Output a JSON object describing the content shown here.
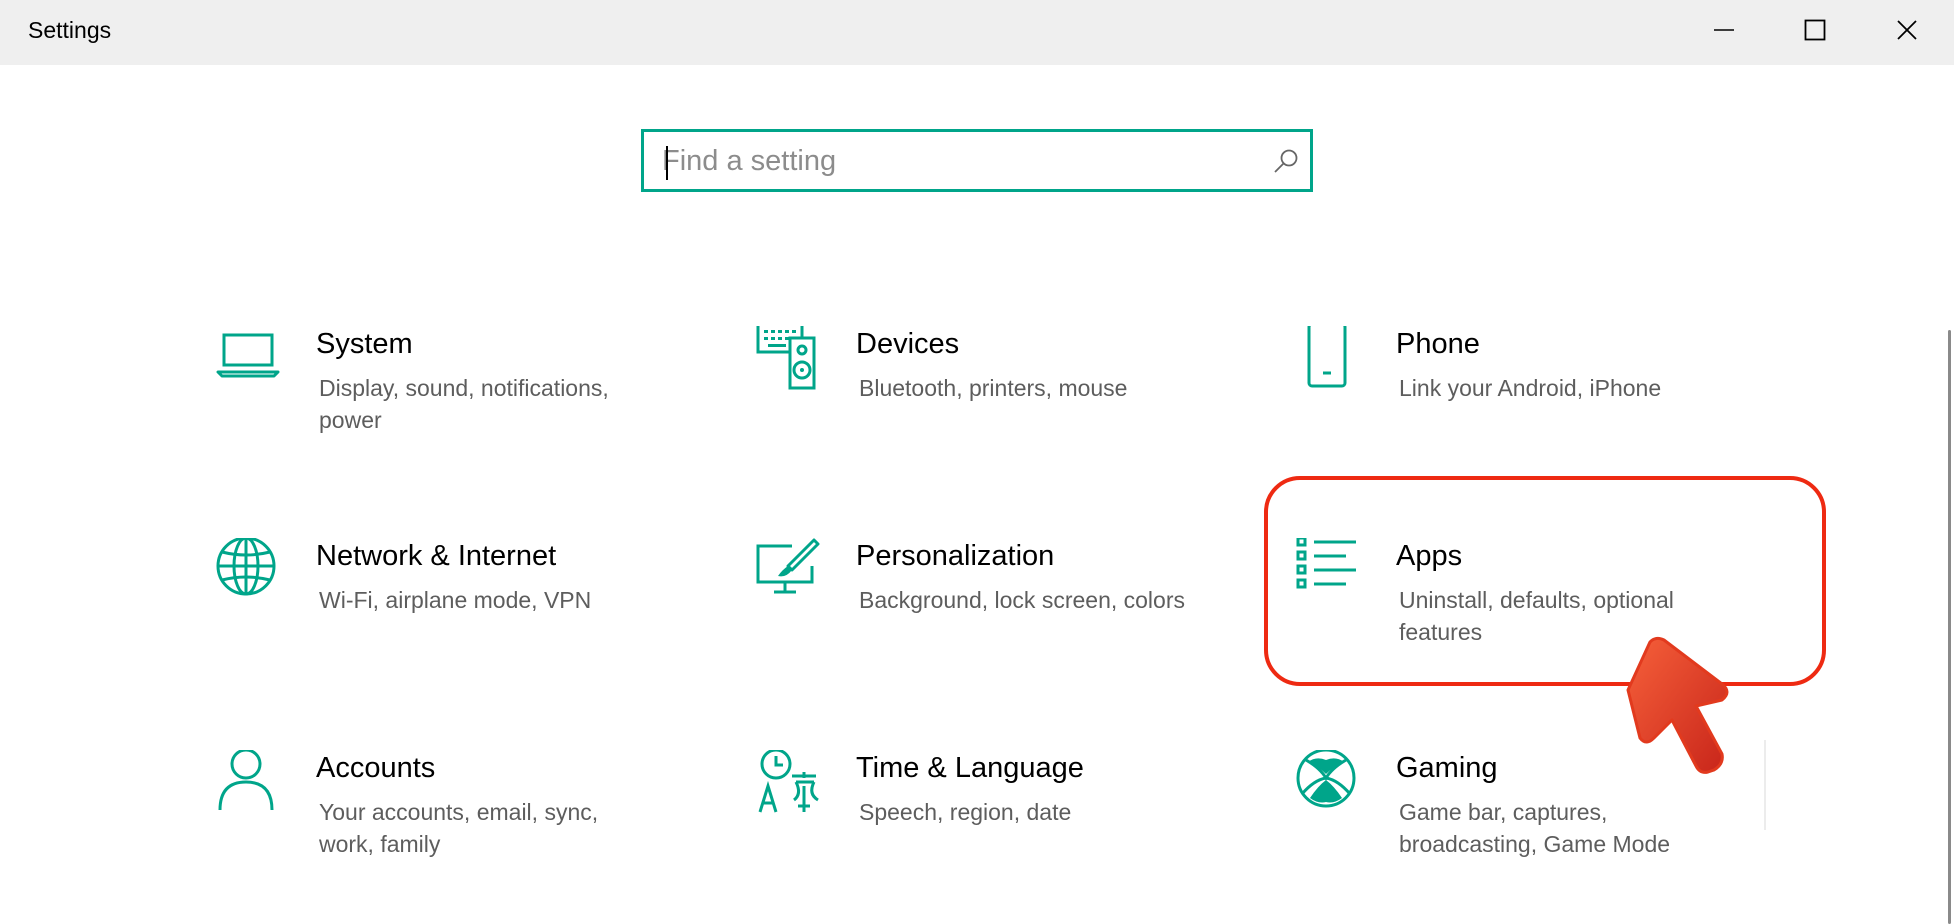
{
  "window": {
    "title": "Settings",
    "controls": {
      "minimize": "minimize",
      "maximize": "maximize",
      "close": "close"
    }
  },
  "search": {
    "placeholder": "Find a setting",
    "value": ""
  },
  "tiles": [
    {
      "name": "System",
      "description": "Display, sound, notifications, power",
      "icon": "laptop-icon"
    },
    {
      "name": "Devices",
      "description": "Bluetooth, printers, mouse",
      "icon": "keyboard-speaker-icon"
    },
    {
      "name": "Phone",
      "description": "Link your Android, iPhone",
      "icon": "phone-icon"
    },
    {
      "name": "Network & Internet",
      "description": "Wi-Fi, airplane mode, VPN",
      "icon": "globe-icon"
    },
    {
      "name": "Personalization",
      "description": "Background, lock screen, colors",
      "icon": "paintbrush-monitor-icon"
    },
    {
      "name": "Apps",
      "description": "Uninstall, defaults, optional features",
      "icon": "apps-list-icon"
    },
    {
      "name": "Accounts",
      "description": "Your accounts, email, sync, work, family",
      "icon": "person-icon"
    },
    {
      "name": "Time & Language",
      "description": "Speech, region, date",
      "icon": "clock-language-icon"
    },
    {
      "name": "Gaming",
      "description": "Game bar, captures, broadcasting, Game Mode",
      "icon": "xbox-icon"
    }
  ],
  "colors": {
    "accent": "#00a58a",
    "highlight": "#ee2a12",
    "title_bar": "#efefef",
    "description_text": "#5d5d5d"
  },
  "annotation": {
    "highlighted_tile": "Apps",
    "pointer": "red-arrow-cursor-icon"
  }
}
